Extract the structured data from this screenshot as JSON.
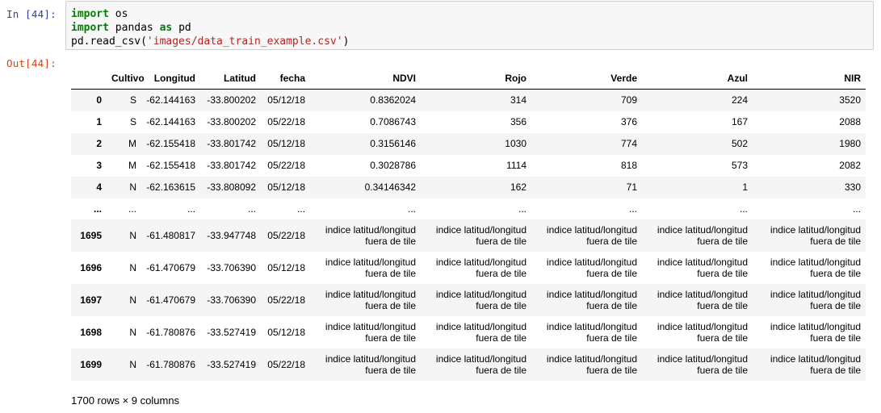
{
  "prompts": {
    "in": "In [44]:",
    "out": "Out[44]:"
  },
  "code": {
    "line1": {
      "kw": "import",
      "rest": " os"
    },
    "line2": {
      "kw1": "import",
      "mid": " pandas ",
      "kw2": "as",
      "rest": " pd"
    },
    "line3": {
      "prefix": "pd.read_csv(",
      "str": "'images/data_train_example.csv'",
      "suffix": ")"
    }
  },
  "table": {
    "columns": [
      "Cultivo",
      "Longitud",
      "Latitud",
      "fecha",
      "NDVI",
      "Rojo",
      "Verde",
      "Azul",
      "NIR"
    ],
    "rows": [
      {
        "index": "0",
        "cells": [
          "S",
          "-62.144163",
          "-33.800202",
          "05/12/18",
          "0.8362024",
          "314",
          "709",
          "224",
          "3520"
        ]
      },
      {
        "index": "1",
        "cells": [
          "S",
          "-62.144163",
          "-33.800202",
          "05/22/18",
          "0.7086743",
          "356",
          "376",
          "167",
          "2088"
        ]
      },
      {
        "index": "2",
        "cells": [
          "M",
          "-62.155418",
          "-33.801742",
          "05/12/18",
          "0.3156146",
          "1030",
          "774",
          "502",
          "1980"
        ]
      },
      {
        "index": "3",
        "cells": [
          "M",
          "-62.155418",
          "-33.801742",
          "05/22/18",
          "0.3028786",
          "1114",
          "818",
          "573",
          "2082"
        ]
      },
      {
        "index": "4",
        "cells": [
          "N",
          "-62.163615",
          "-33.808092",
          "05/12/18",
          "0.34146342",
          "162",
          "71",
          "1",
          "330"
        ]
      },
      {
        "index": "...",
        "cells": [
          "...",
          "...",
          "...",
          "...",
          "...",
          "...",
          "...",
          "...",
          "..."
        ]
      },
      {
        "index": "1695",
        "cells": [
          "N",
          "-61.480817",
          "-33.947748",
          "05/22/18",
          "indice latitud/longitud fuera de tile",
          "indice latitud/longitud fuera de tile",
          "indice latitud/longitud fuera de tile",
          "indice latitud/longitud fuera de tile",
          "indice latitud/longitud fuera de tile"
        ]
      },
      {
        "index": "1696",
        "cells": [
          "N",
          "-61.470679",
          "-33.706390",
          "05/12/18",
          "indice latitud/longitud fuera de tile",
          "indice latitud/longitud fuera de tile",
          "indice latitud/longitud fuera de tile",
          "indice latitud/longitud fuera de tile",
          "indice latitud/longitud fuera de tile"
        ]
      },
      {
        "index": "1697",
        "cells": [
          "N",
          "-61.470679",
          "-33.706390",
          "05/22/18",
          "indice latitud/longitud fuera de tile",
          "indice latitud/longitud fuera de tile",
          "indice latitud/longitud fuera de tile",
          "indice latitud/longitud fuera de tile",
          "indice latitud/longitud fuera de tile"
        ]
      },
      {
        "index": "1698",
        "cells": [
          "N",
          "-61.780876",
          "-33.527419",
          "05/12/18",
          "indice latitud/longitud fuera de tile",
          "indice latitud/longitud fuera de tile",
          "indice latitud/longitud fuera de tile",
          "indice latitud/longitud fuera de tile",
          "indice latitud/longitud fuera de tile"
        ]
      },
      {
        "index": "1699",
        "cells": [
          "N",
          "-61.780876",
          "-33.527419",
          "05/22/18",
          "indice latitud/longitud fuera de tile",
          "indice latitud/longitud fuera de tile",
          "indice latitud/longitud fuera de tile",
          "indice latitud/longitud fuera de tile",
          "indice latitud/longitud fuera de tile"
        ]
      }
    ]
  },
  "summary": "1700 rows × 9 columns",
  "colors": {
    "in_prompt": "#303f9f",
    "out_prompt": "#d84315",
    "keyword": "#008000",
    "string": "#ba2121",
    "cell_bg": "#f7f7f7",
    "stripe": "#f5f5f5"
  }
}
